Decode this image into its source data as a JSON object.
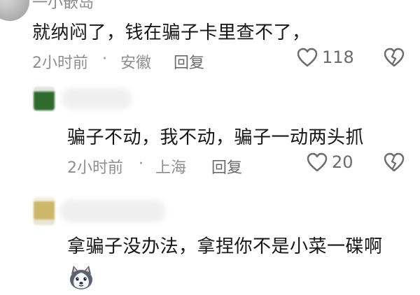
{
  "top_partial_name": "一小嵌岛",
  "comments": [
    {
      "text": "就纳闷了，钱在骗子卡里查不了，",
      "time": "2小时前",
      "location": "安徽",
      "reply_label": "回复",
      "likes": "118"
    },
    {
      "text": "骗子不动，我不动，骗子一动两头抓",
      "time": "2小时前",
      "location": "上海",
      "reply_label": "回复",
      "likes": "20"
    },
    {
      "text": "拿骗子没办法，拿捏你不是小菜一碟啊",
      "emoji": "husky-emoji"
    }
  ],
  "separator": "·",
  "colors": {
    "text": "#161616",
    "meta": "#8e8e8e",
    "icon": "#6b6b6b",
    "avatar2": "#2f6b2c",
    "avatar3": "#cdb76a"
  }
}
